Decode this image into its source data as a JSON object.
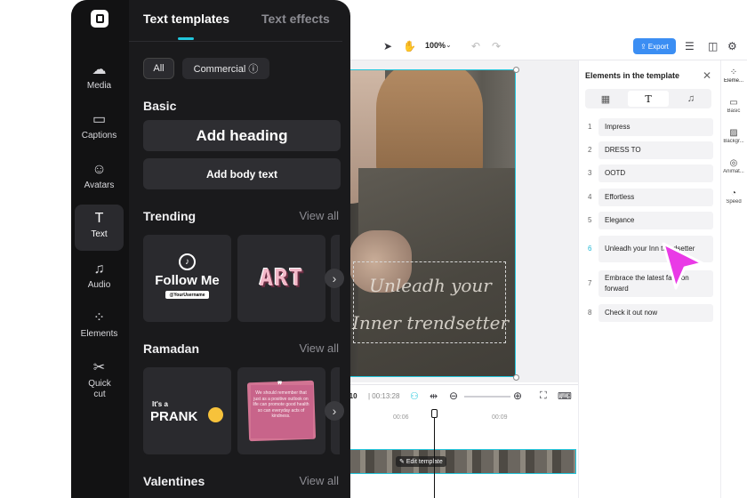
{
  "colors": {
    "accent": "#21c6dc",
    "export": "#3b8ef3",
    "cursor": "#e93ae6",
    "panel_bg": "#1a1a1c"
  },
  "editor": {
    "zoom": "100%",
    "export_label": "Export",
    "time_current": ":10",
    "time_total": "| 00:13:28",
    "ruler": [
      "00:06",
      "00:09"
    ],
    "edit_template_label": "Edit template",
    "canvas_text": "Unleadh your Inner trendsetter",
    "icons": [
      "select-arrow-icon",
      "hand-icon",
      "undo-icon",
      "redo-icon",
      "layers-icon",
      "layout-icon",
      "settings-icon"
    ]
  },
  "elements_panel": {
    "title": "Elements in the template",
    "tabs": [
      {
        "icon": "film-icon",
        "glyph": "▦"
      },
      {
        "icon": "text-icon",
        "glyph": "T"
      },
      {
        "icon": "music-icon",
        "glyph": "♫"
      }
    ],
    "items": [
      {
        "num": "1",
        "label": "Impress"
      },
      {
        "num": "2",
        "label": "DRESS TO"
      },
      {
        "num": "3",
        "label": "OOTD"
      },
      {
        "num": "4",
        "label": "Effortless"
      },
      {
        "num": "5",
        "label": "Elegance"
      },
      {
        "num": "6",
        "label": "Unleadh your Inn trendsetter"
      },
      {
        "num": "7",
        "label": "Embrace the latest fashion forward"
      },
      {
        "num": "8",
        "label": "Check it out now"
      }
    ]
  },
  "right_rail": [
    {
      "label": "Eleme...",
      "icon": "elements-icon"
    },
    {
      "label": "Basic",
      "icon": "basic-icon"
    },
    {
      "label": "Backgr...",
      "icon": "background-icon"
    },
    {
      "label": "Animat...",
      "icon": "animation-icon"
    },
    {
      "label": "Speed",
      "icon": "speed-icon"
    }
  ],
  "left_nav": [
    {
      "label": "Media",
      "icon": "cloud-upload-icon",
      "glyph": "☁"
    },
    {
      "label": "Captions",
      "icon": "captions-icon",
      "glyph": "▭"
    },
    {
      "label": "Avatars",
      "icon": "avatar-icon",
      "glyph": "☺"
    },
    {
      "label": "Text",
      "icon": "text-icon",
      "glyph": "T"
    },
    {
      "label": "Audio",
      "icon": "music-icon",
      "glyph": "♫"
    },
    {
      "label": "Elements",
      "icon": "elements-icon",
      "glyph": "⁘"
    },
    {
      "label": "Quick cut",
      "icon": "scissors-icon",
      "glyph": "✂"
    }
  ],
  "text_panel": {
    "tab_active": "Text templates",
    "tab_other": "Text effects",
    "chips": [
      "All",
      "Commercial ⓘ"
    ],
    "basic_title": "Basic",
    "add_heading": "Add heading",
    "add_body": "Add body text",
    "trending_title": "Trending",
    "ramadan_title": "Ramadan",
    "valentines_title": "Valentines",
    "view_all": "View all",
    "follow_title": "Follow Me",
    "follow_user": "@YourUsername",
    "art_text": "ART",
    "prank_small": "It's a",
    "prank_big": "PRANK",
    "quote_text": "We should remember that just as a positive outlook on life can promote good health so can everyday acts of kindness."
  }
}
